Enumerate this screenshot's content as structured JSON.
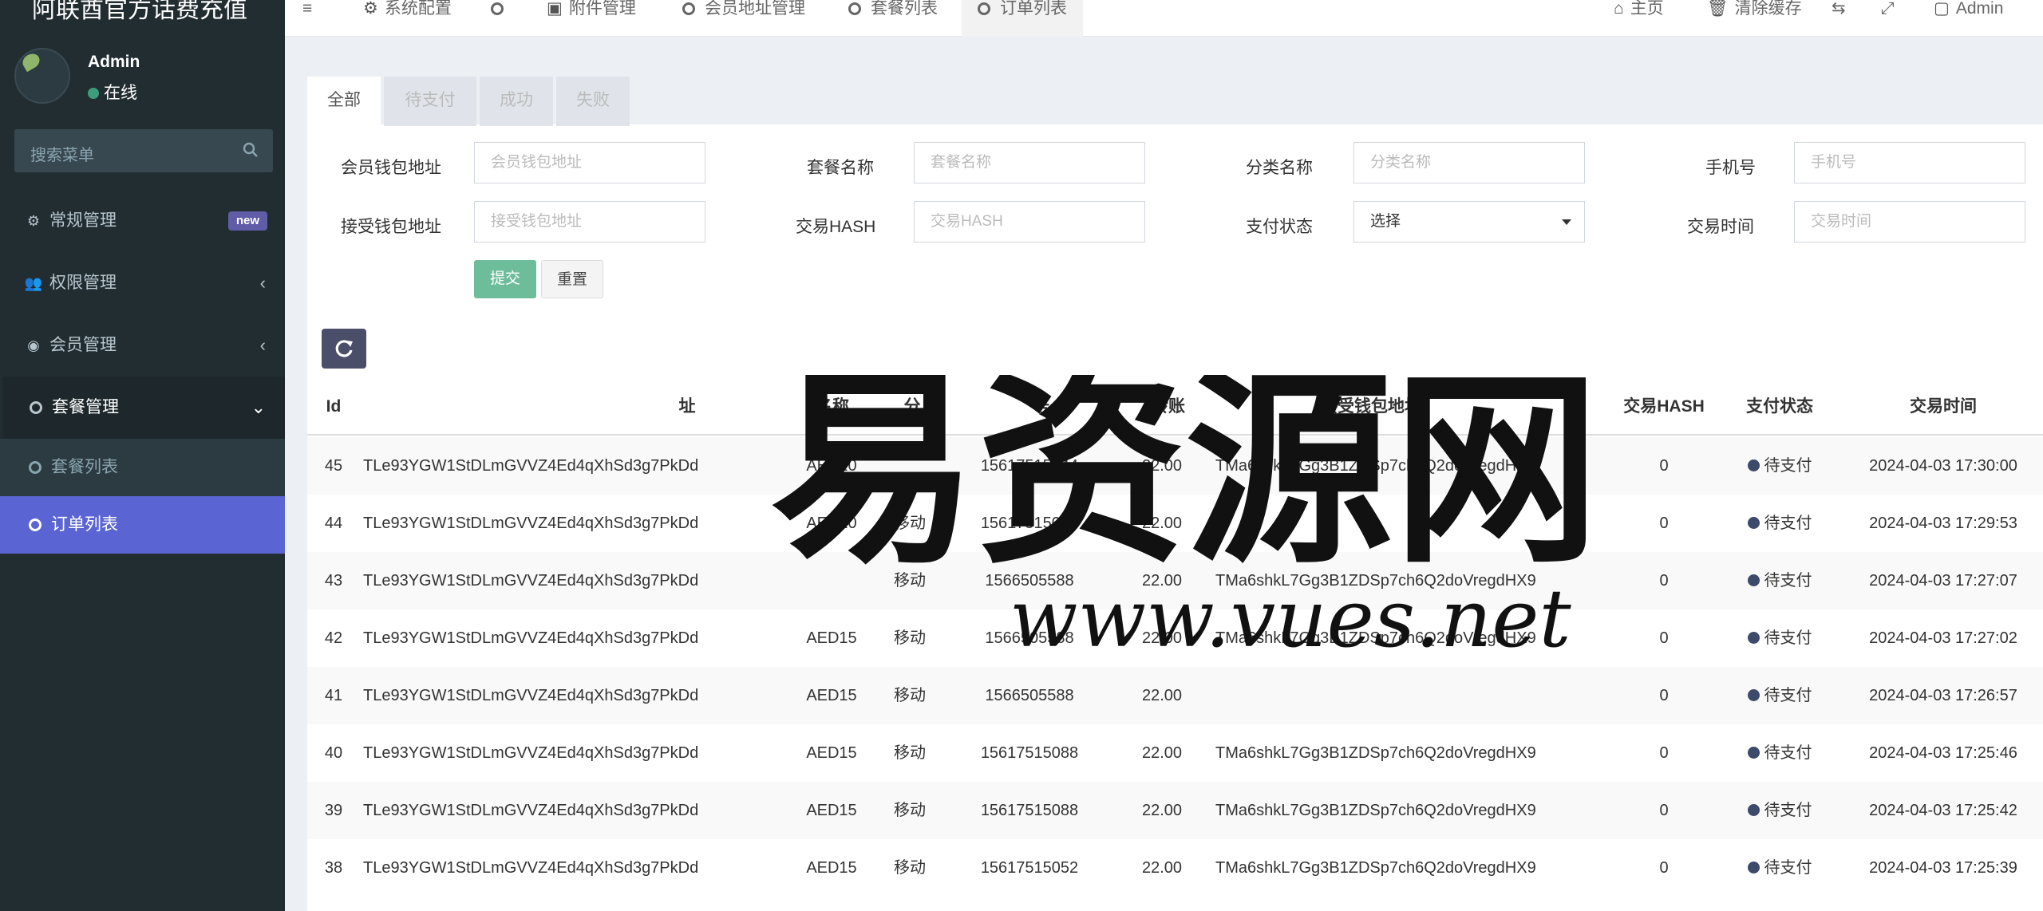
{
  "app": {
    "brand": "阿联酋官方话费充值"
  },
  "user": {
    "name": "Admin",
    "status": "在线"
  },
  "sidebar": {
    "search_placeholder": "搜索菜单",
    "items": [
      {
        "label": "常规管理",
        "icon": "cogs-icon",
        "badge": "new"
      },
      {
        "label": "权限管理",
        "icon": "users-icon",
        "arrow": "‹"
      },
      {
        "label": "会员管理",
        "icon": "user-circle-icon",
        "arrow": "‹"
      },
      {
        "label": "套餐管理",
        "icon": "ring-icon",
        "arrow": "⌄"
      }
    ],
    "subitems": [
      {
        "label": "套餐列表"
      },
      {
        "label": "订单列表"
      }
    ]
  },
  "topbar": {
    "menu_icon": "≡",
    "tabs": [
      {
        "label": "系统配置",
        "icon": "gear-icon"
      },
      {
        "label": "",
        "icon": "ring-icon"
      },
      {
        "label": "附件管理",
        "icon": "image-icon"
      },
      {
        "label": "会员地址管理",
        "icon": "ring-icon"
      },
      {
        "label": "套餐列表",
        "icon": "ring-icon"
      },
      {
        "label": "订单列表",
        "icon": "ring-icon"
      }
    ],
    "right": {
      "home": "主页",
      "clear_cache": "清除缓存",
      "user": "Admin"
    }
  },
  "tabs": [
    "全部",
    "待支付",
    "成功",
    "失败"
  ],
  "filters": {
    "member_wallet": {
      "label": "会员钱包地址",
      "placeholder": "会员钱包地址"
    },
    "package_name": {
      "label": "套餐名称",
      "placeholder": "套餐名称"
    },
    "category_name": {
      "label": "分类名称",
      "placeholder": "分类名称"
    },
    "phone": {
      "label": "手机号",
      "placeholder": "手机号"
    },
    "receive_wallet": {
      "label": "接受钱包地址",
      "placeholder": "接受钱包地址"
    },
    "tx_hash": {
      "label": "交易HASH",
      "placeholder": "交易HASH"
    },
    "pay_status": {
      "label": "支付状态",
      "value": "选择"
    },
    "tx_time": {
      "label": "交易时间",
      "placeholder": "交易时间"
    },
    "submit": "提交",
    "reset": "重置"
  },
  "table": {
    "headers": {
      "id": "Id",
      "member_wallet": "址",
      "package": "名称",
      "category": "分",
      "phone": "号",
      "amount": "转账",
      "receive_wallet": "接受钱包地址",
      "hash": "交易HASH",
      "status": "支付状态",
      "time": "交易时间"
    },
    "rows": [
      {
        "id": "45",
        "member_wallet": "TLe93YGW1StDLmGVVZ4Ed4qXhSd3g7PkDd",
        "package": "AED10",
        "category": "",
        "phone": "15617515044",
        "amount": "22.00",
        "receive_wallet": "TMa6shkL7Gg3B1ZDSp7ch6Q2doVregdHX9",
        "hash": "0",
        "status": "待支付",
        "time": "2024-04-03 17:30:00"
      },
      {
        "id": "44",
        "member_wallet": "TLe93YGW1StDLmGVVZ4Ed4qXhSd3g7PkDd",
        "package": "AED10",
        "category": "移动",
        "phone": "15617515044",
        "amount": "22.00",
        "receive_wallet": "",
        "hash": "0",
        "status": "待支付",
        "time": "2024-04-03 17:29:53"
      },
      {
        "id": "43",
        "member_wallet": "TLe93YGW1StDLmGVVZ4Ed4qXhSd3g7PkDd",
        "package": "",
        "category": "移动",
        "phone": "1566505588",
        "amount": "22.00",
        "receive_wallet": "TMa6shkL7Gg3B1ZDSp7ch6Q2doVregdHX9",
        "hash": "0",
        "status": "待支付",
        "time": "2024-04-03 17:27:07"
      },
      {
        "id": "42",
        "member_wallet": "TLe93YGW1StDLmGVVZ4Ed4qXhSd3g7PkDd",
        "package": "AED15",
        "category": "移动",
        "phone": "1566505588",
        "amount": "22.00",
        "receive_wallet": "TMa6shkL7Gg3B1ZDSp7ch6Q2doVregdHX9",
        "hash": "0",
        "status": "待支付",
        "time": "2024-04-03 17:27:02"
      },
      {
        "id": "41",
        "member_wallet": "TLe93YGW1StDLmGVVZ4Ed4qXhSd3g7PkDd",
        "package": "AED15",
        "category": "移动",
        "phone": "1566505588",
        "amount": "22.00",
        "receive_wallet": "",
        "hash": "0",
        "status": "待支付",
        "time": "2024-04-03 17:26:57"
      },
      {
        "id": "40",
        "member_wallet": "TLe93YGW1StDLmGVVZ4Ed4qXhSd3g7PkDd",
        "package": "AED15",
        "category": "移动",
        "phone": "15617515088",
        "amount": "22.00",
        "receive_wallet": "TMa6shkL7Gg3B1ZDSp7ch6Q2doVregdHX9",
        "hash": "0",
        "status": "待支付",
        "time": "2024-04-03 17:25:46"
      },
      {
        "id": "39",
        "member_wallet": "TLe93YGW1StDLmGVVZ4Ed4qXhSd3g7PkDd",
        "package": "AED15",
        "category": "移动",
        "phone": "15617515088",
        "amount": "22.00",
        "receive_wallet": "TMa6shkL7Gg3B1ZDSp7ch6Q2doVregdHX9",
        "hash": "0",
        "status": "待支付",
        "time": "2024-04-03 17:25:42"
      },
      {
        "id": "38",
        "member_wallet": "TLe93YGW1StDLmGVVZ4Ed4qXhSd3g7PkDd",
        "package": "AED15",
        "category": "移动",
        "phone": "15617515052",
        "amount": "22.00",
        "receive_wallet": "TMa6shkL7Gg3B1ZDSp7ch6Q2doVregdHX9",
        "hash": "0",
        "status": "待支付",
        "time": "2024-04-03 17:25:39"
      }
    ]
  },
  "watermark": {
    "title": "易资源网",
    "url": "www.vues.net"
  },
  "colors": {
    "sidebar_bg": "#222d32",
    "active_sub": "#5a64d2",
    "submit": "#6dbd9b",
    "refresh": "#4b4e69",
    "status_dot": "#3c4a6b"
  }
}
